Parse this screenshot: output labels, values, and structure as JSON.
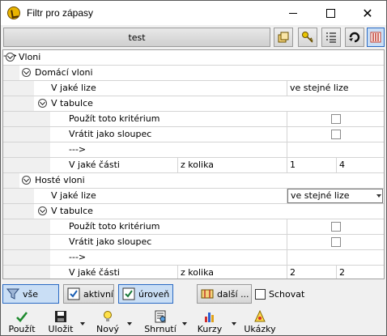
{
  "window": {
    "title": "Filtr pro zápasy"
  },
  "header": {
    "button_label": "test"
  },
  "toolbar_icons": [
    "copy-icon",
    "key-icon",
    "list-icon",
    "refresh-icon",
    "columns-icon"
  ],
  "tree": {
    "vloni": "Vloni",
    "domaci": {
      "label": "Domácí vloni",
      "liga_label": "V jaké lize",
      "liga_value": "ve stejné lize",
      "tabulka_label": "V tabulce",
      "krit_label": "Použít toto kritérium",
      "sloupec_label": "Vrátit jako sloupec",
      "arrow": "--->",
      "cast_label": "V jaké části",
      "z_kolika": "z kolika",
      "cast_a": "1",
      "cast_b": "4"
    },
    "hoste": {
      "label": "Hosté vloni",
      "liga_label": "V jaké lize",
      "liga_value": "ve stejné lize",
      "tabulka_label": "V tabulce",
      "krit_label": "Použít toto kritérium",
      "sloupec_label": "Vrátit jako sloupec",
      "arrow": "--->",
      "cast_label": "V jaké části",
      "z_kolika": "z kolika",
      "cast_a": "2",
      "cast_b": "2"
    }
  },
  "filterbar": {
    "vse": "vše",
    "aktivni": "aktivní",
    "uroven": "úroveň",
    "dalsi": "další ...",
    "schovat": "Schovat"
  },
  "actions": {
    "pouzit": "Použít",
    "ulozit": "Uložit",
    "novy": "Nový",
    "shrnuti": "Shrnutí",
    "kurzy": "Kurzy",
    "ukazky": "Ukázky"
  }
}
